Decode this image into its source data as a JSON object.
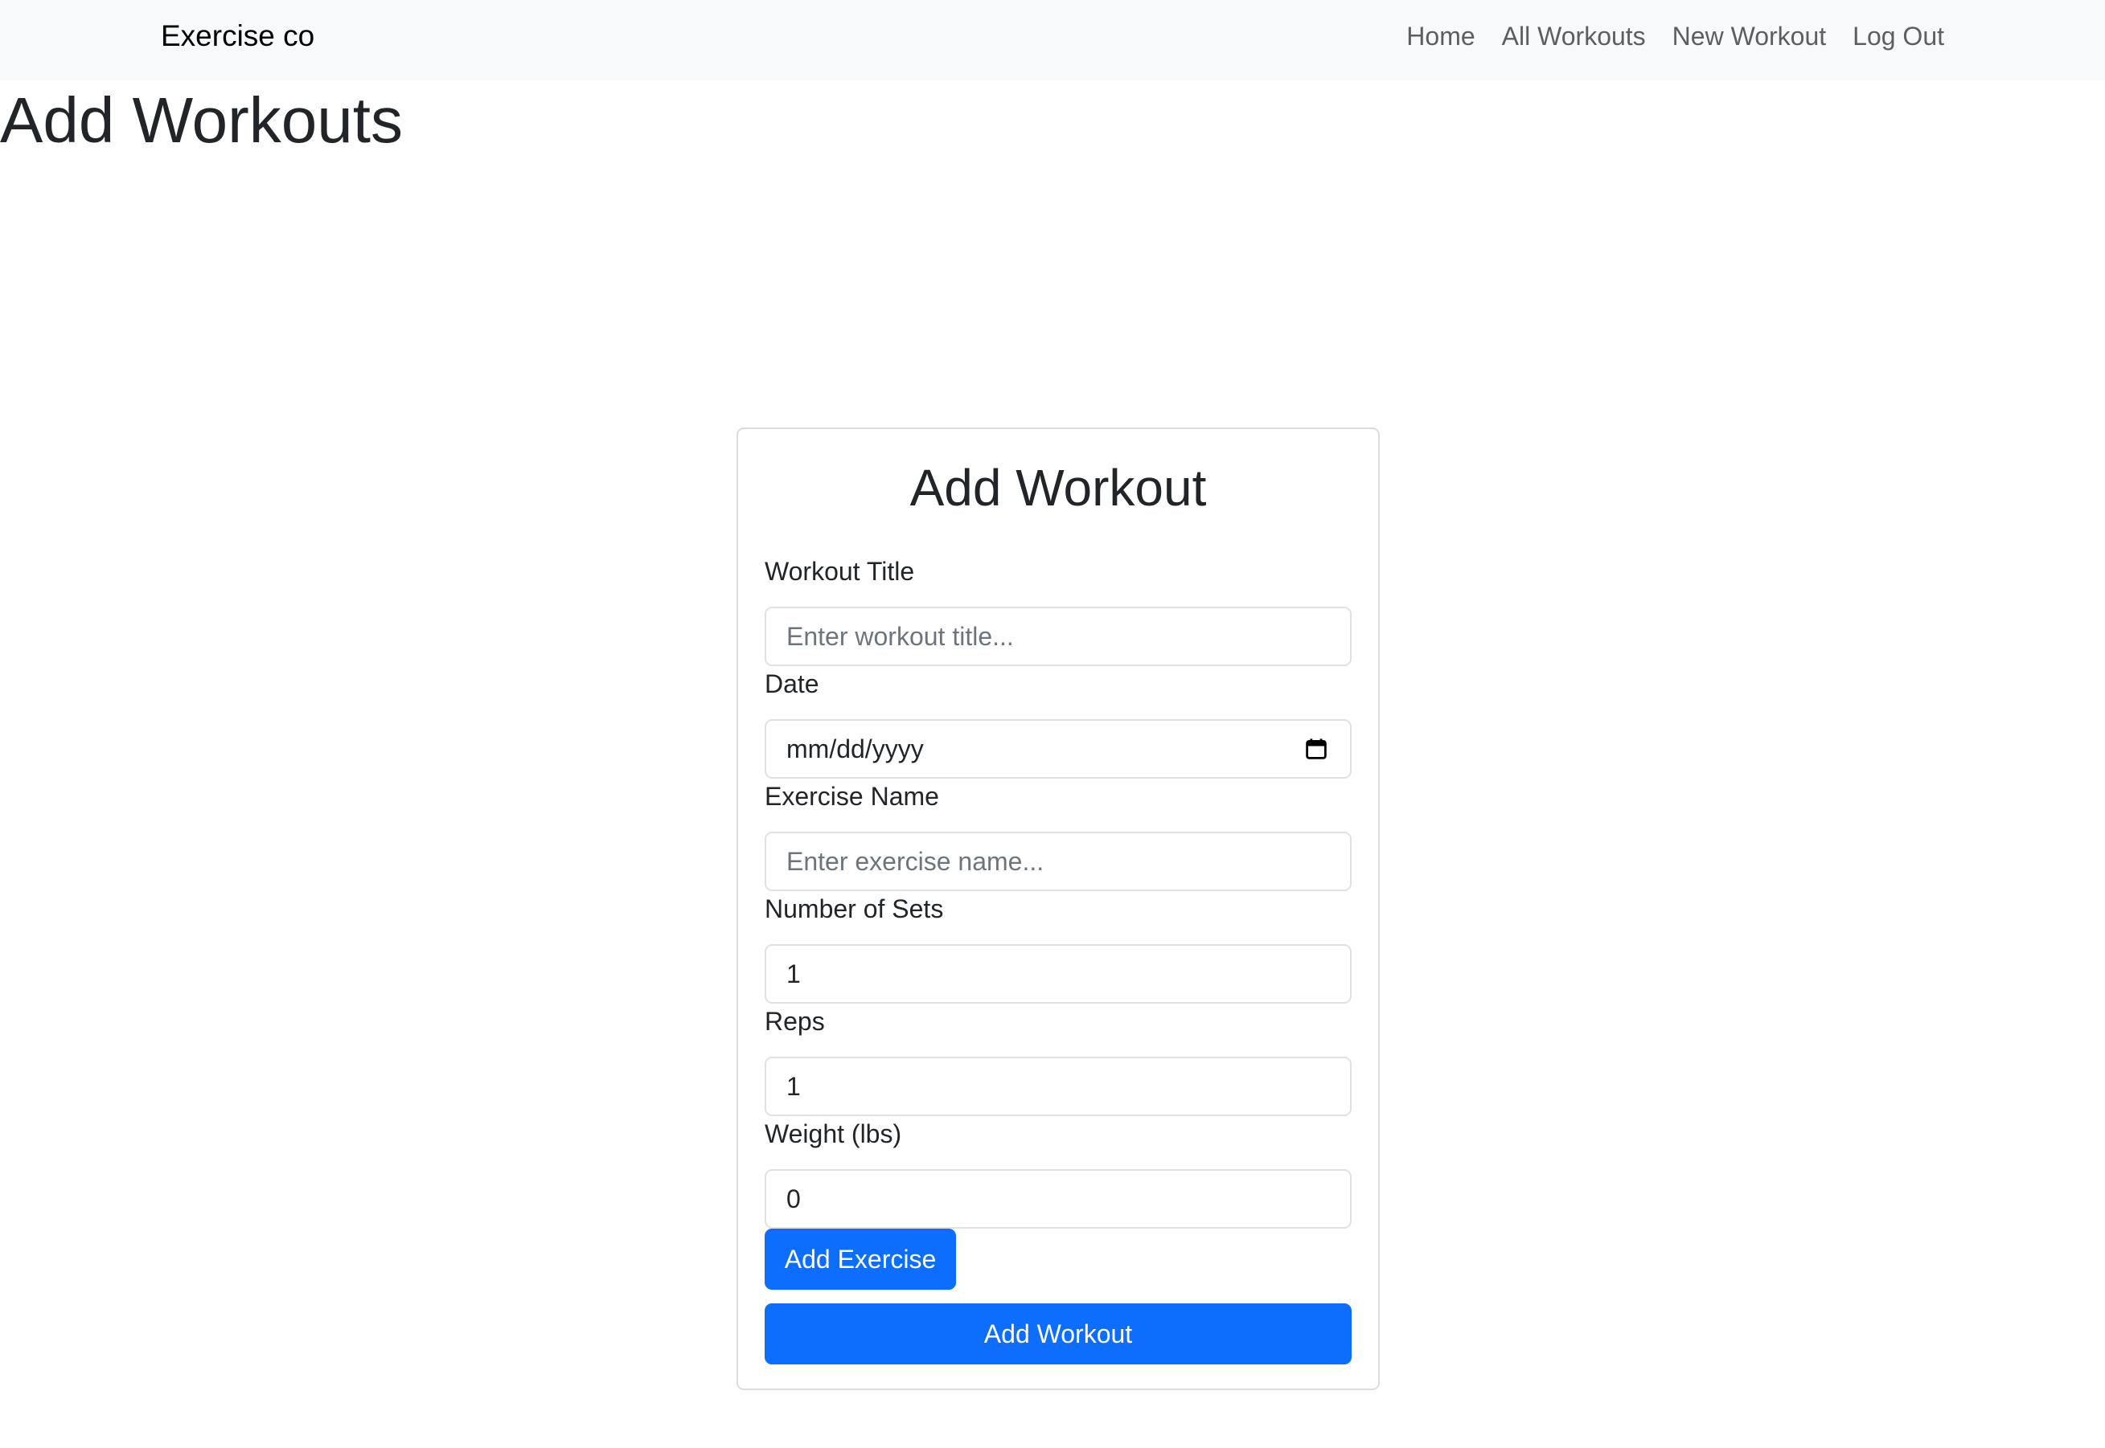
{
  "navbar": {
    "brand": "Exercise co",
    "links": [
      "Home",
      "All Workouts",
      "New Workout",
      "Log Out"
    ]
  },
  "page": {
    "title": "Add Workouts"
  },
  "form": {
    "title": "Add Workout",
    "workout_title": {
      "label": "Workout Title",
      "placeholder": "Enter workout title...",
      "value": ""
    },
    "date": {
      "label": "Date",
      "display": "mm/dd/yyyy"
    },
    "exercise_name": {
      "label": "Exercise Name",
      "placeholder": "Enter exercise name...",
      "value": ""
    },
    "sets": {
      "label": "Number of Sets",
      "value": "1"
    },
    "reps": {
      "label": "Reps",
      "value": "1"
    },
    "weight": {
      "label": "Weight (lbs)",
      "value": "0"
    },
    "add_exercise_label": "Add Exercise",
    "add_workout_label": "Add Workout"
  },
  "colors": {
    "primary": "#0d6efd",
    "navbar_bg": "#f8f9fa",
    "text": "#212529",
    "muted": "#6c757d"
  },
  "icons": {
    "date_picker": "calendar-icon"
  }
}
